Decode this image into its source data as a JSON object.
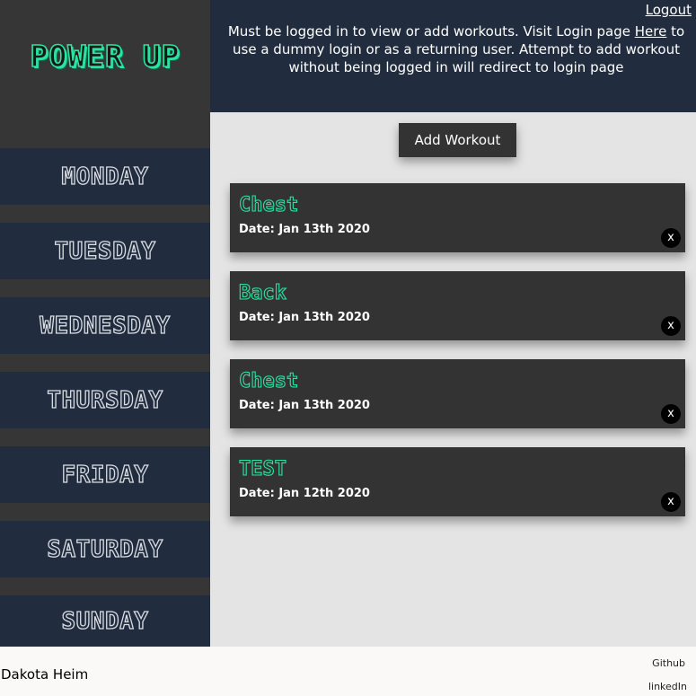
{
  "brand": {
    "logo_text": "POWER UP"
  },
  "sidebar": {
    "days": [
      {
        "label": "MONDAY"
      },
      {
        "label": "TUESDAY"
      },
      {
        "label": "WEDNESDAY"
      },
      {
        "label": "THURSDAY"
      },
      {
        "label": "FRIDAY"
      },
      {
        "label": "SATURDAY"
      },
      {
        "label": "SUNDAY"
      }
    ]
  },
  "header": {
    "logout_label": "Logout",
    "notice_text": "Must be logged in to view or add workouts. Visit Login page ",
    "notice_link": "Here",
    "notice_tail": " to use a dummy login or as a returning user. Attempt to add workout without being logged in will redirect to login page"
  },
  "main": {
    "add_button_label": "Add Workout",
    "workouts": [
      {
        "title": "Chest",
        "date": "Date: Jan 13th 2020",
        "close": "x"
      },
      {
        "title": "Back",
        "date": "Date: Jan 13th 2020",
        "close": "x"
      },
      {
        "title": "Chest",
        "date": "Date: Jan 13th 2020",
        "close": "x"
      },
      {
        "title": "TEST",
        "date": "Date: Jan 12th 2020",
        "close": "x"
      }
    ]
  },
  "footer": {
    "author": "Dakota Heim",
    "github_label": "Github",
    "linkedin_label": "linkedIn"
  },
  "colors": {
    "accent": "#2be3a3",
    "navy": "#212d3f",
    "dark": "#333333",
    "sidebar_bg": "#363636",
    "main_bg": "#e4e4e4"
  }
}
